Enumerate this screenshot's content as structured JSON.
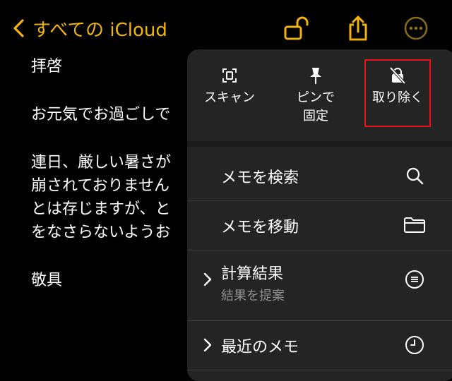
{
  "nav": {
    "back_label": "すべての iCloud",
    "accent": "#f5b40d"
  },
  "note": {
    "lines": [
      "拝啓",
      "お元気でお過ごしで",
      "連日、厳しい暑さが",
      "崩されておりません",
      "とは存じますが、と",
      "をなさらないようお",
      "敬具"
    ]
  },
  "menu": {
    "actions": [
      {
        "label": "スキャン",
        "icon": "scan-icon"
      },
      {
        "label_line1": "ピンで",
        "label_line2": "固定",
        "icon": "pin-icon"
      },
      {
        "label": "取り除く",
        "icon": "unlock-slash-icon"
      }
    ],
    "items": [
      {
        "title": "メモを検索",
        "icon": "search-icon"
      },
      {
        "title": "メモを移動",
        "icon": "folder-icon"
      },
      {
        "title": "計算結果",
        "subtitle": "結果を提案",
        "icon": "equal-circle-icon"
      },
      {
        "title": "最近のメモ",
        "icon": "clock-icon"
      }
    ]
  }
}
